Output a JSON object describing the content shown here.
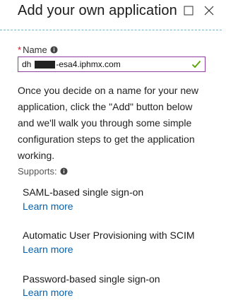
{
  "header": {
    "title": "Add your own application"
  },
  "name_field": {
    "label": "Name",
    "required_marker": "*",
    "value_start": "dh",
    "value_end": "-esa4.iphmx.com"
  },
  "description": "Once you decide on a name for your new application, click the \"Add\" button below and we'll walk you through some simple configuration steps to get the application working.",
  "supports": {
    "label": "Supports:",
    "items": [
      {
        "title": "SAML-based single sign-on",
        "link": "Learn more"
      },
      {
        "title": "Automatic User Provisioning with SCIM",
        "link": "Learn more"
      },
      {
        "title": "Password-based single sign-on",
        "link": "Learn more"
      }
    ]
  },
  "colors": {
    "accent_border": "#8f3d9f",
    "link": "#0063b1",
    "required": "#e00b1c",
    "valid_check": "#57a300",
    "separator": "#6fb7cf"
  },
  "icons": {
    "maximize": "maximize-icon",
    "close": "close-icon",
    "info": "info-icon",
    "valid": "check-icon"
  }
}
